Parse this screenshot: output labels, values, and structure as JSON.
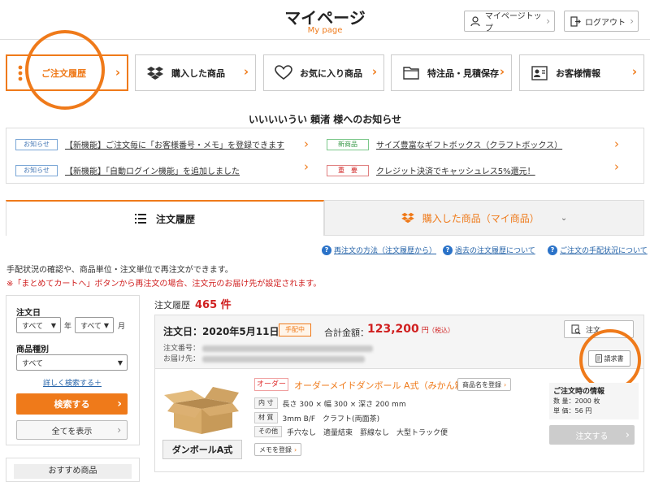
{
  "header": {
    "title": "マイページ",
    "subtitle": "My page",
    "mypage_top": "マイページトップ",
    "logout": "ログアウト"
  },
  "nav": [
    {
      "label": "ご注文履歴",
      "icon": "menu-dots-icon"
    },
    {
      "label": "購入した商品",
      "icon": "dropbox-icon"
    },
    {
      "label": "お気に入り商品",
      "icon": "heart-icon"
    },
    {
      "label": "特注品・見積保存",
      "icon": "folder-icon"
    },
    {
      "label": "お客様情報",
      "icon": "id-card-icon"
    }
  ],
  "notices": {
    "title": "いいいいうい 頼渚 様へのお知らせ",
    "items": [
      {
        "tag": "お知らせ",
        "text": "【新機能】ご注文毎に「お客様番号・メモ」を登録できます"
      },
      {
        "tag": "新商品",
        "text": "サイズ豊富なギフトボックス（クラフトボックス）"
      },
      {
        "tag": "お知らせ",
        "text": "【新機能】「自動ログイン機能」を追加しました"
      },
      {
        "tag": "重　要",
        "text": "クレジット決済でキャッシュレス5%還元！"
      }
    ]
  },
  "tabs": {
    "history": "注文履歴",
    "purchased": "購入した商品（マイ商品）"
  },
  "help_links": [
    "再注文の方法（注文履歴から）",
    "過去の注文履歴について",
    "ご注文の手配状況について"
  ],
  "desc": {
    "line1": "手配状況の確認や、商品単位・注文単位で再注文ができます。",
    "line2": "※「まとめてカートへ」ボタンから再注文の場合、注文元のお届け先が設定されます。"
  },
  "filter": {
    "date_label": "注文日",
    "year_value": "すべて",
    "year_suffix": "年",
    "month_value": "すべて",
    "month_suffix": "月",
    "type_label": "商品種別",
    "type_value": "すべて",
    "detail_link": "詳しく検索する＋",
    "search_button": "検索する",
    "show_all_button": "全てを表示",
    "recommend_title": "おすすめ商品"
  },
  "orders": {
    "count_label": "注文履歴",
    "count_value": "465 件",
    "date": "注文日：2020年5月11日",
    "status": "手配中",
    "total_label": "合計金額：",
    "total_value": "123,200",
    "total_suffix": "円",
    "tax": "（税込）",
    "order_no_label": "注文番号：",
    "ship_to_label": "お届け先：",
    "detail_button": "注文",
    "invoice_button": "請求書",
    "product_image_name": "ダンボールA式",
    "order_tag": "オーダー",
    "order_name": "オーダーメイドダンボール A式（みかん箱）",
    "product_name_button": "商品名を登録",
    "specs": [
      {
        "label": "内 寸",
        "value": "長さ 300 × 幅 300 × 深さ 200 mm"
      },
      {
        "label": "材 質",
        "value": "3mm B/F　クラフト(両面茶)"
      },
      {
        "label": "その他",
        "value": "手穴なし　適量結束　罫線なし　大型トラック便"
      }
    ],
    "memo_button": "メモを登録",
    "info_title": "ご注文時の情報",
    "qty_line": "数 量：2000 枚",
    "price_line": "単 価：56 円",
    "order_button": "注文する"
  },
  "colors": {
    "accent": "#ef7a1a",
    "price": "#d02020",
    "link": "#2563a8"
  }
}
